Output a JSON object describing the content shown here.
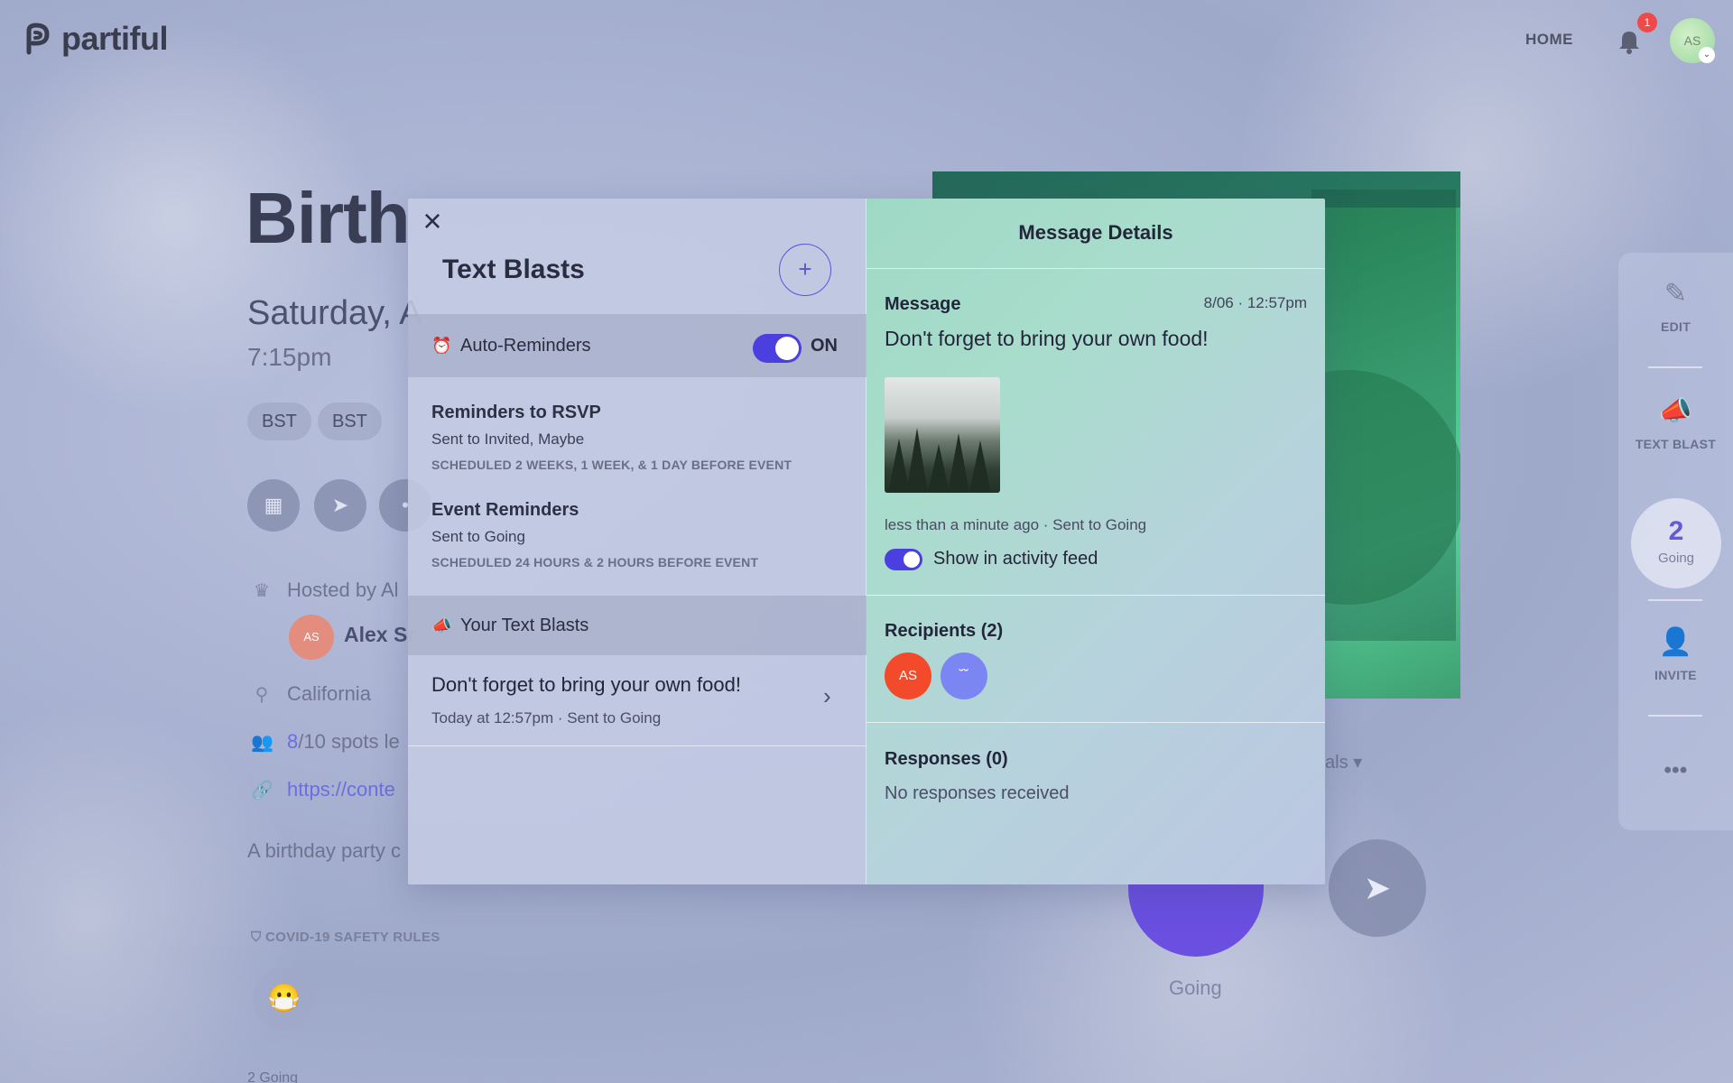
{
  "app": {
    "logo_text": "partiful",
    "nav_home": "HOME",
    "notification_count": "1",
    "user_initials": "AS"
  },
  "event": {
    "title_partial": "Birth",
    "date_partial": "Saturday, A",
    "time": "7:15pm",
    "chips": [
      "BST",
      "BST"
    ],
    "host_label_partial": "Hosted by Al",
    "host_initials": "AS",
    "host_name_partial": "Alex Sr",
    "location": "California",
    "spots_number": "8",
    "spots_rest_partial": "/10 spots le",
    "link_partial": "https://conte",
    "description_partial": "A birthday party c",
    "covid_label": "COVID-19 SAFETY RULES",
    "going_count_text": "2 Going",
    "rsvp_label": "Going",
    "dropdown_partial": "als"
  },
  "rail": {
    "edit_label": "EDIT",
    "text_blast_label": "TEXT BLAST",
    "going_count": "2",
    "going_label": "Going",
    "invite_label": "INVITE",
    "more_label": "•••"
  },
  "text_blasts": {
    "title": "Text Blasts",
    "add_label": "+",
    "close_label": "×",
    "auto_reminders": {
      "label": "Auto-Reminders",
      "toggle_state": "ON"
    },
    "reminders": [
      {
        "title": "Reminders to RSVP",
        "sent_to": "Sent to Invited, Maybe",
        "schedule": "SCHEDULED 2 WEEKS, 1 WEEK, & 1 DAY BEFORE EVENT"
      },
      {
        "title": "Event Reminders",
        "sent_to": "Sent to Going",
        "schedule": "SCHEDULED 24 HOURS & 2 HOURS BEFORE EVENT"
      }
    ],
    "your_blasts_label": "Your Text Blasts",
    "blasts": [
      {
        "message": "Don't forget to bring your own food!",
        "meta": "Today at 12:57pm · Sent to Going"
      }
    ]
  },
  "message_details": {
    "header": "Message Details",
    "message_label": "Message",
    "timestamp": "8/06 · 12:57pm",
    "message_text": "Don't forget to bring your own food!",
    "status": "less than a minute ago · Sent to Going",
    "activity_feed_label": "Show in activity feed",
    "recipients_label": "Recipients (2)",
    "recipients": [
      {
        "initials": "AS",
        "color": "#f24a2b"
      },
      {
        "initials": "˘˘",
        "color": "#7b86f2"
      }
    ],
    "responses_label": "Responses (0)",
    "no_responses": "No responses received"
  },
  "colors": {
    "accent": "#4b3fe0",
    "purple_link": "#6b6ee0"
  }
}
